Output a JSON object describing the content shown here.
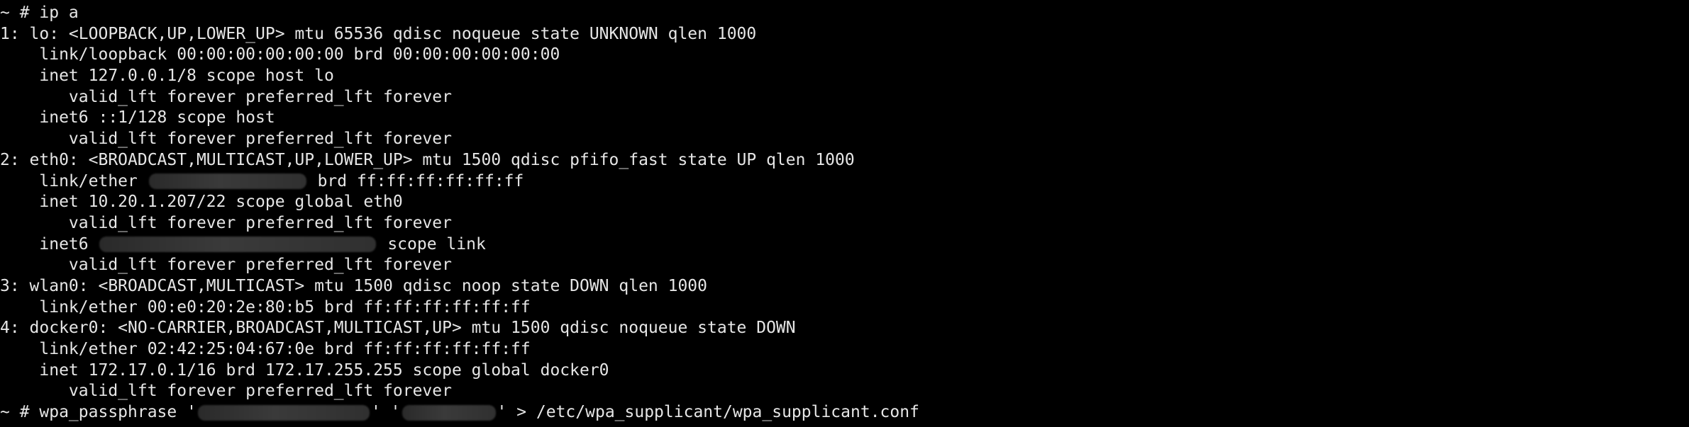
{
  "terminal": {
    "background": "#000000",
    "foreground": "#e6e6e6",
    "lines": {
      "l0": "~ # ip a",
      "l1": "1: lo: <LOOPBACK,UP,LOWER_UP> mtu 65536 qdisc noqueue state UNKNOWN qlen 1000",
      "l2": "    link/loopback 00:00:00:00:00:00 brd 00:00:00:00:00:00",
      "l3": "    inet 127.0.0.1/8 scope host lo",
      "l4": "       valid_lft forever preferred_lft forever",
      "l5": "    inet6 ::1/128 scope host",
      "l6": "       valid_lft forever preferred_lft forever",
      "l7": "2: eth0: <BROADCAST,MULTICAST,UP,LOWER_UP> mtu 1500 qdisc pfifo_fast state UP qlen 1000",
      "l8a": "    link/ether ",
      "l8b": " brd ff:ff:ff:ff:ff:ff",
      "l9": "    inet 10.20.1.207/22 scope global eth0",
      "l10": "       valid_lft forever preferred_lft forever",
      "l11a": "    inet6 ",
      "l11b": " scope link",
      "l12": "       valid_lft forever preferred_lft forever",
      "l13": "3: wlan0: <BROADCAST,MULTICAST> mtu 1500 qdisc noop state DOWN qlen 1000",
      "l14": "    link/ether 00:e0:20:2e:80:b5 brd ff:ff:ff:ff:ff:ff",
      "l15": "4: docker0: <NO-CARRIER,BROADCAST,MULTICAST,UP> mtu 1500 qdisc noqueue state DOWN",
      "l16": "    link/ether 02:42:25:04:67:0e brd ff:ff:ff:ff:ff:ff",
      "l17": "    inet 172.17.0.1/16 brd 172.17.255.255 scope global docker0",
      "l18": "       valid_lft forever preferred_lft forever",
      "l19a": "~ # wpa_passphrase '",
      "l19b": "' '",
      "l19c": "' > /etc/wpa_supplicant/wpa_supplicant.conf"
    }
  }
}
